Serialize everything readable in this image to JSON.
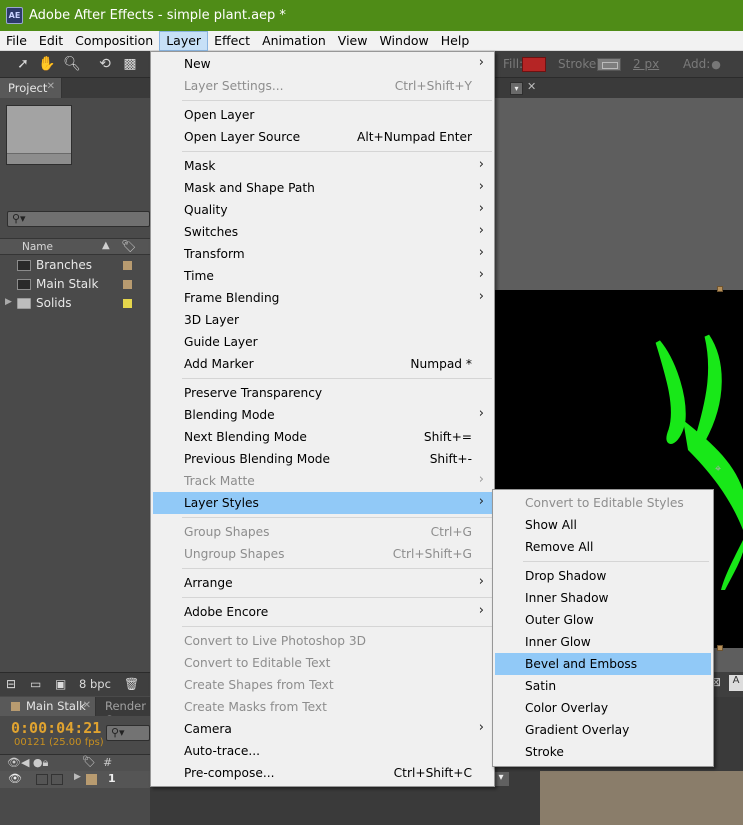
{
  "window": {
    "title": "Adobe After Effects - simple plant.aep *",
    "app_icon_text": "AE"
  },
  "menubar": {
    "items": [
      "File",
      "Edit",
      "Composition",
      "Layer",
      "Effect",
      "Animation",
      "View",
      "Window",
      "Help"
    ],
    "active": "Layer"
  },
  "toolbar": {
    "fill_label": "Fill:",
    "stroke_label": "Stroke:",
    "stroke_width": "2 px",
    "add_label": "Add:",
    "fill_color": "#b52525"
  },
  "project_panel": {
    "tab_label": "Project",
    "column_name": "Name",
    "items": [
      {
        "name": "Branches",
        "type": "composition",
        "label_color": "#b89b70"
      },
      {
        "name": "Main Stalk",
        "type": "composition",
        "label_color": "#b89b70"
      },
      {
        "name": "Solids",
        "type": "folder",
        "label_color": "#e5d64c"
      }
    ],
    "bit_depth": "8 bpc"
  },
  "timeline": {
    "tab_label": "Main Stalk",
    "tab2_label": "Render Q",
    "timecode": "0:00:04:21",
    "frame_info": "00121 (25.00 fps)",
    "layer_number": "1"
  },
  "layer_menu": {
    "sections": [
      [
        {
          "label": "New",
          "submenu": true
        },
        {
          "label": "Layer Settings...",
          "shortcut": "Ctrl+Shift+Y",
          "disabled": true
        }
      ],
      [
        {
          "label": "Open Layer"
        },
        {
          "label": "Open Layer Source",
          "shortcut": "Alt+Numpad Enter"
        }
      ],
      [
        {
          "label": "Mask",
          "submenu": true
        },
        {
          "label": "Mask and Shape Path",
          "submenu": true
        },
        {
          "label": "Quality",
          "submenu": true
        },
        {
          "label": "Switches",
          "submenu": true
        },
        {
          "label": "Transform",
          "submenu": true
        },
        {
          "label": "Time",
          "submenu": true
        },
        {
          "label": "Frame Blending",
          "submenu": true
        },
        {
          "label": "3D Layer"
        },
        {
          "label": "Guide Layer"
        },
        {
          "label": "Add Marker",
          "shortcut": "Numpad *"
        }
      ],
      [
        {
          "label": "Preserve Transparency"
        },
        {
          "label": "Blending Mode",
          "submenu": true
        },
        {
          "label": "Next Blending Mode",
          "shortcut": "Shift+="
        },
        {
          "label": "Previous Blending Mode",
          "shortcut": "Shift+-"
        },
        {
          "label": "Track Matte",
          "submenu": true,
          "disabled": true
        },
        {
          "label": "Layer Styles",
          "submenu": true,
          "highlight": true
        }
      ],
      [
        {
          "label": "Group Shapes",
          "shortcut": "Ctrl+G",
          "disabled": true
        },
        {
          "label": "Ungroup Shapes",
          "shortcut": "Ctrl+Shift+G",
          "disabled": true
        }
      ],
      [
        {
          "label": "Arrange",
          "submenu": true
        }
      ],
      [
        {
          "label": "Adobe Encore",
          "submenu": true
        }
      ],
      [
        {
          "label": "Convert to Live Photoshop 3D",
          "disabled": true
        },
        {
          "label": "Convert to Editable Text",
          "disabled": true
        },
        {
          "label": "Create Shapes from Text",
          "disabled": true
        },
        {
          "label": "Create Masks from Text",
          "disabled": true
        },
        {
          "label": "Camera",
          "submenu": true
        },
        {
          "label": "Auto-trace..."
        },
        {
          "label": "Pre-compose...",
          "shortcut": "Ctrl+Shift+C"
        }
      ]
    ]
  },
  "layer_styles_submenu": {
    "sections": [
      [
        {
          "label": "Convert to Editable Styles",
          "disabled": true
        },
        {
          "label": "Show All"
        },
        {
          "label": "Remove All"
        }
      ],
      [
        {
          "label": "Drop Shadow"
        },
        {
          "label": "Inner Shadow"
        },
        {
          "label": "Outer Glow"
        },
        {
          "label": "Inner Glow"
        },
        {
          "label": "Bevel and Emboss",
          "highlight": true
        },
        {
          "label": "Satin"
        },
        {
          "label": "Color Overlay"
        },
        {
          "label": "Gradient Overlay"
        },
        {
          "label": "Stroke"
        }
      ]
    ]
  },
  "colors": {
    "title_bar": "#4f8c17",
    "menu_highlight": "#91c9f7",
    "plant_green": "#18e818",
    "timecode": "#e0a330"
  }
}
